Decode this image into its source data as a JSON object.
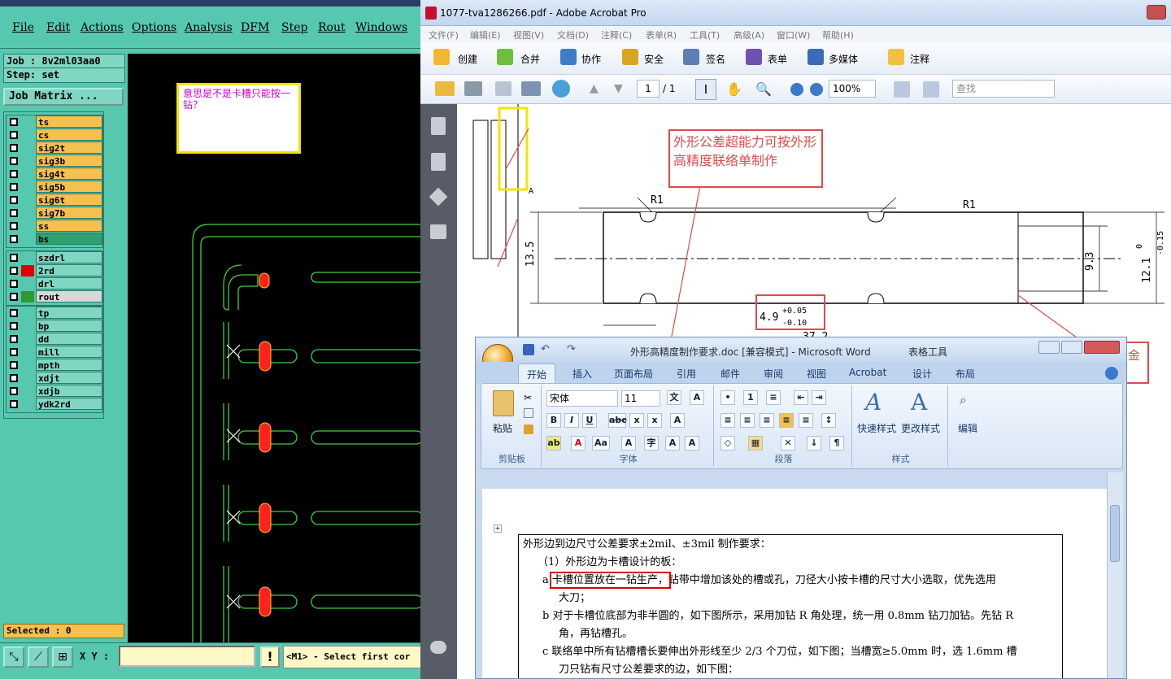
{
  "cam": {
    "menu": [
      "File",
      "Edit",
      "Actions",
      "Options",
      "Analysis",
      "DFM",
      "Step",
      "Rout",
      "Windows"
    ],
    "job": "Job : 8v2ml03aa0",
    "step": "Step: set",
    "job_matrix": "Job Matrix ...",
    "layer_groups": [
      [
        {
          "name": "ts",
          "color": "#f6c04e",
          "swatch": ""
        },
        {
          "name": "cs",
          "color": "#f6c04e",
          "swatch": ""
        },
        {
          "name": "sig2t",
          "color": "#f6c04e",
          "swatch": ""
        },
        {
          "name": "sig3b",
          "color": "#f6c04e",
          "swatch": ""
        },
        {
          "name": "sig4t",
          "color": "#f6c04e",
          "swatch": ""
        },
        {
          "name": "sig5b",
          "color": "#f6c04e",
          "swatch": ""
        },
        {
          "name": "sig6t",
          "color": "#f6c04e",
          "swatch": ""
        },
        {
          "name": "sig7b",
          "color": "#f6c04e",
          "swatch": ""
        },
        {
          "name": "ss",
          "color": "#f6c04e",
          "swatch": ""
        },
        {
          "name": "bs",
          "color": "#2fa06e",
          "swatch": ""
        }
      ],
      [
        {
          "name": "szdrl",
          "color": "#7fd6c3",
          "swatch": ""
        },
        {
          "name": "2rd",
          "color": "#7fd6c3",
          "swatch": "#e00000"
        },
        {
          "name": "drl",
          "color": "#7fd6c3",
          "swatch": ""
        },
        {
          "name": "rout",
          "color": "#d8d8d8",
          "swatch": "#2e9a2e"
        }
      ],
      [
        {
          "name": "tp",
          "color": "#7fd6c3",
          "swatch": ""
        },
        {
          "name": "bp",
          "color": "#7fd6c3",
          "swatch": ""
        },
        {
          "name": "dd",
          "color": "#7fd6c3",
          "swatch": ""
        },
        {
          "name": "mill",
          "color": "#7fd6c3",
          "swatch": ""
        },
        {
          "name": "mpth",
          "color": "#7fd6c3",
          "swatch": ""
        },
        {
          "name": "xdjt",
          "color": "#7fd6c3",
          "swatch": ""
        },
        {
          "name": "xdjb",
          "color": "#7fd6c3",
          "swatch": ""
        },
        {
          "name": "ydk2rd",
          "color": "#7fd6c3",
          "swatch": ""
        }
      ]
    ],
    "selected": "Selected : 0",
    "xy_label": "X Y :",
    "alert": "!",
    "prompt": "<M1> - Select first cor",
    "note": "意思是不是卡槽只能按一钻？"
  },
  "acrobat": {
    "title": "1077-tva1286266.pdf - Adobe Acrobat Pro",
    "menu": [
      "文件(F)",
      "编辑(E)",
      "视图(V)",
      "文档(D)",
      "注释(C)",
      "表单(R)",
      "工具(T)",
      "高级(A)",
      "窗口(W)",
      "帮助(H)"
    ],
    "toolbar": [
      "创建",
      "合并",
      "协作",
      "安全",
      "签名",
      "表单",
      "多媒体",
      "注释"
    ],
    "page_current": "1",
    "page_total": "/ 1",
    "zoom": "100%",
    "search_placeholder": "查找",
    "annotation_1": "外形公差超能力可按外形高精度联络单制作",
    "annotation_2": "金",
    "dims": {
      "d1": "13.5",
      "d2": "9.3",
      "d3": "12.1",
      "d3_tol_a": "0",
      "d3_tol_b": "-0.15",
      "d4": "4.9",
      "d4_tol_a": "+0.05",
      "d4_tol_b": "-0.10",
      "d5": "37.2",
      "r1": "R1",
      "r2": "R1",
      "label_a": "A"
    }
  },
  "word": {
    "title": "外形高精度制作要求.doc [兼容模式] - Microsoft Word",
    "tools_label": "表格工具",
    "tabs": [
      "开始",
      "插入",
      "页面布局",
      "引用",
      "邮件",
      "审阅",
      "视图",
      "Acrobat",
      "设计",
      "布局"
    ],
    "font_name": "宋体",
    "font_size": "11",
    "groups": {
      "clipboard": "剪贴板",
      "font": "字体",
      "paragraph": "段落",
      "styles": "样式"
    },
    "paste": "粘贴",
    "quick_styles": "快速样式",
    "change_styles": "更改样式",
    "edit": "编辑",
    "doc": {
      "line1": "外形边到边尺寸公差要求±2mil、±3mil 制作要求：",
      "line2": "（1）外形边为卡槽设计的板：",
      "a_label": "a",
      "a_highlight": "卡槽位置放在一钻生产，",
      "a_rest": "钻带中增加该处的槽或孔，刀径大小按卡槽的尺寸大小选取，优先选用",
      "a_cont": "大刀；",
      "b_label": "b",
      "b_text": "对于卡槽位底部为非半圆的，如下图所示，采用加钻 R 角处理，统一用 0.8mm 钻刀加钻。先钻 R",
      "b_cont": "角，再钻槽孔。",
      "c_label": "c",
      "c_text": "联络单中所有钻槽槽长要伸出外形线至少 2/3 个刀位，如下图；当槽宽≥5.0mm 时，选 1.6mm 槽",
      "c_cont": "刀只钻有尺寸公差要求的边，如下图："
    }
  }
}
